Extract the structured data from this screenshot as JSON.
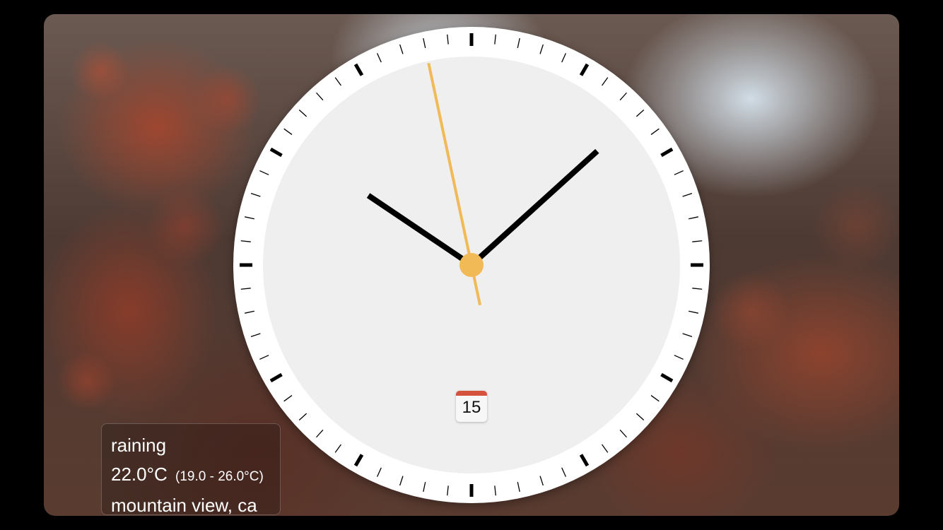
{
  "clock": {
    "time": {
      "hour": 10,
      "minute": 7,
      "second": 58
    },
    "date_day": "15",
    "colors": {
      "bezel": "#ffffff",
      "face": "#efefef",
      "hands": "#000000",
      "second_hand": "#f2b957",
      "date_band": "#d5533c"
    }
  },
  "weather": {
    "condition": "raining",
    "temperature": "22.0°C",
    "range": "(19.0 - 26.0°C)",
    "location": "mountain view, ca"
  }
}
